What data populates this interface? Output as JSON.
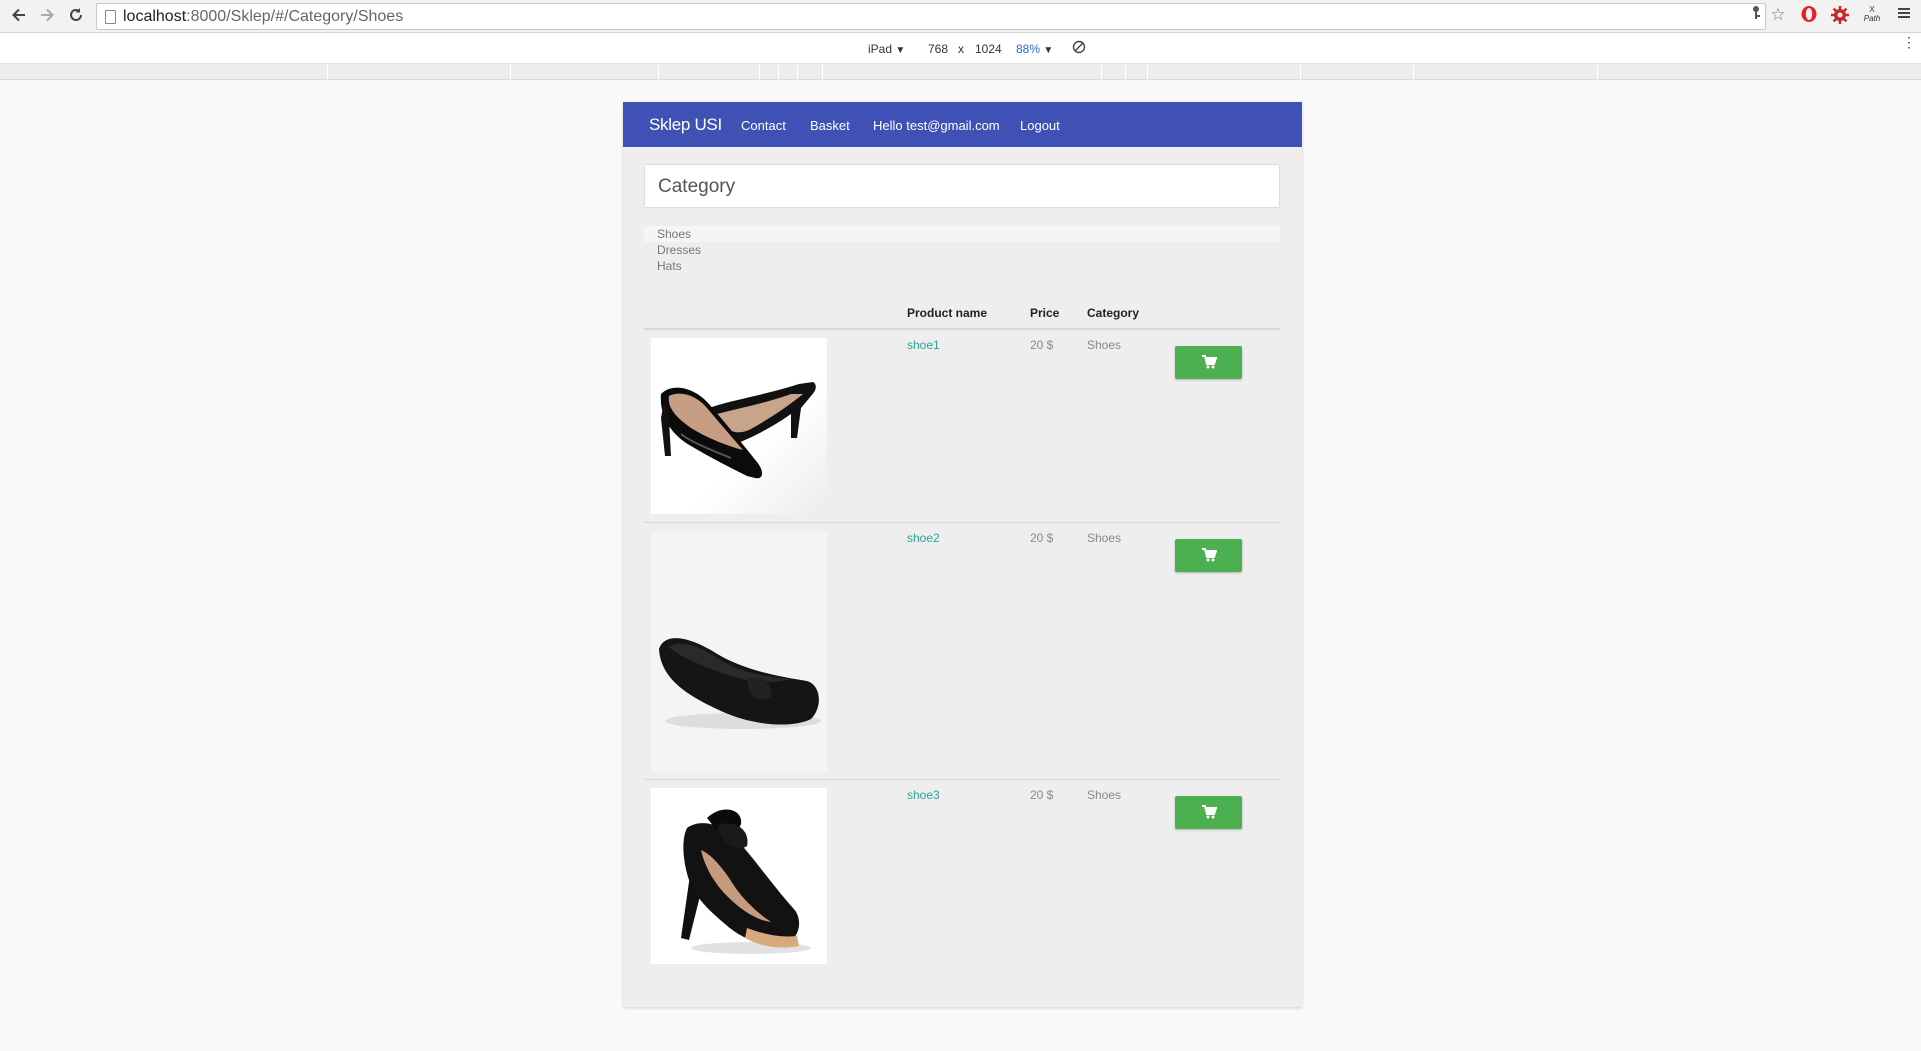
{
  "browser": {
    "url_host": "localhost",
    "url_path": ":8000/Sklep/#/Category/Shoes",
    "icons": [
      "back-icon",
      "forward-icon",
      "reload-icon",
      "page-icon",
      "key-icon",
      "star-icon",
      "opera-icon",
      "gear-extension-icon",
      "xpath-icon",
      "menu-icon"
    ],
    "xpath_label_top": "X",
    "xpath_label_bottom": "Path"
  },
  "device_toolbar": {
    "device": "iPad",
    "width": "768",
    "times": "x",
    "height": "1024",
    "zoom": "88%",
    "arrow": "▼"
  },
  "nav": {
    "brand": "Sklep USI",
    "links": [
      "Contact",
      "Basket",
      "Hello test@gmail.com",
      "Logout"
    ],
    "bg_color": "#3f51b5"
  },
  "category_card": {
    "title": "Category"
  },
  "categories": [
    "Shoes",
    "Dresses",
    "Hats"
  ],
  "table": {
    "headers": [
      "Product name",
      "Price",
      "Category"
    ],
    "rows": [
      {
        "name": "shoe1",
        "price": "20 $",
        "category": "Shoes",
        "image": "black-patent-pumps"
      },
      {
        "name": "shoe2",
        "price": "20 $",
        "category": "Shoes",
        "image": "black-ballet-flat"
      },
      {
        "name": "shoe3",
        "price": "20 $",
        "category": "Shoes",
        "image": "black-bow-platform-heel"
      }
    ]
  },
  "colors": {
    "link": "#26a69a",
    "button": "#4caf50",
    "page_bg": "#eeeeee"
  }
}
